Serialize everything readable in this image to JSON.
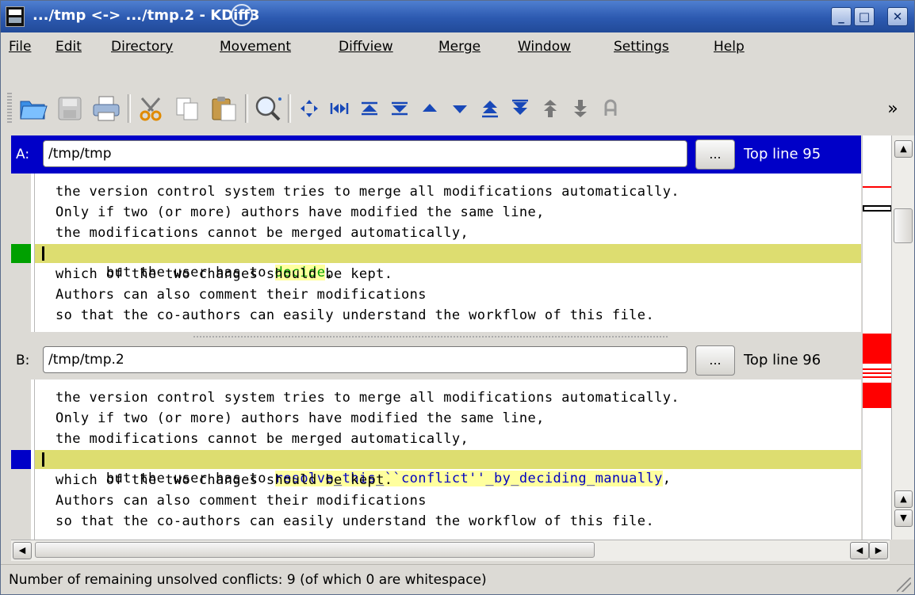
{
  "window": {
    "title": ".../tmp <-> .../tmp.2 - KDiff3"
  },
  "menu": [
    "File",
    "Edit",
    "Directory",
    "Movement",
    "Diffview",
    "Merge",
    "Window",
    "Settings",
    "Help"
  ],
  "toolbar": {
    "icons": [
      "open-icon",
      "save-icon",
      "print-icon",
      "cut-icon",
      "copy-icon",
      "paste-icon",
      "search-icon",
      "goto-current-delta-icon",
      "goto-first-delta-icon",
      "goto-first-delta-icon",
      "goto-last-delta-icon",
      "goto-prev-delta-icon",
      "goto-next-delta-icon",
      "goto-prev-conflict-icon",
      "goto-next-conflict-icon",
      "goto-prev-unsolved-icon",
      "goto-next-unsolved-icon",
      "select-a-icon"
    ],
    "overflow": "»"
  },
  "pane_a": {
    "label": "A:",
    "path": "/tmp/tmp",
    "browse": "...",
    "top_line": "Top line 95",
    "lines": [
      "the version control system tries to merge all modifications automatically.",
      "Only if two (or more) authors have modified the same line,",
      "the modifications cannot be merged automatically,",
      "which of the two changes should be kept.",
      "Authors can also comment their modifications",
      "so that the co-authors can easily understand the workflow of this file."
    ],
    "diff_line": {
      "prefix": "but the user has to ",
      "changed": "decide",
      "suffix": ","
    }
  },
  "pane_b": {
    "label": "B:",
    "path": "/tmp/tmp.2",
    "browse": "...",
    "top_line": "Top line 96",
    "lines": [
      "the version control system tries to merge all modifications automatically.",
      "Only if two (or more) authors have modified the same line,",
      "the modifications cannot be merged automatically,",
      "which of the two changes should be kept.",
      "Authors can also comment their modifications",
      "so that the co-authors can easily understand the workflow of this file."
    ],
    "diff_line": {
      "prefix": "but the user has to ",
      "changed": "resolve_this_``conflict''_by_deciding_manually",
      "suffix": ","
    }
  },
  "status": "Number of remaining unsolved conflicts: 9 (of which 0 are whitespace)",
  "colors": {
    "pane_a_marker": "#00a000",
    "pane_b_marker": "#0000c8",
    "active_header": "#0000c8",
    "diff_line_bg": "#dddd70",
    "overview_conflict": "#ff0000"
  }
}
